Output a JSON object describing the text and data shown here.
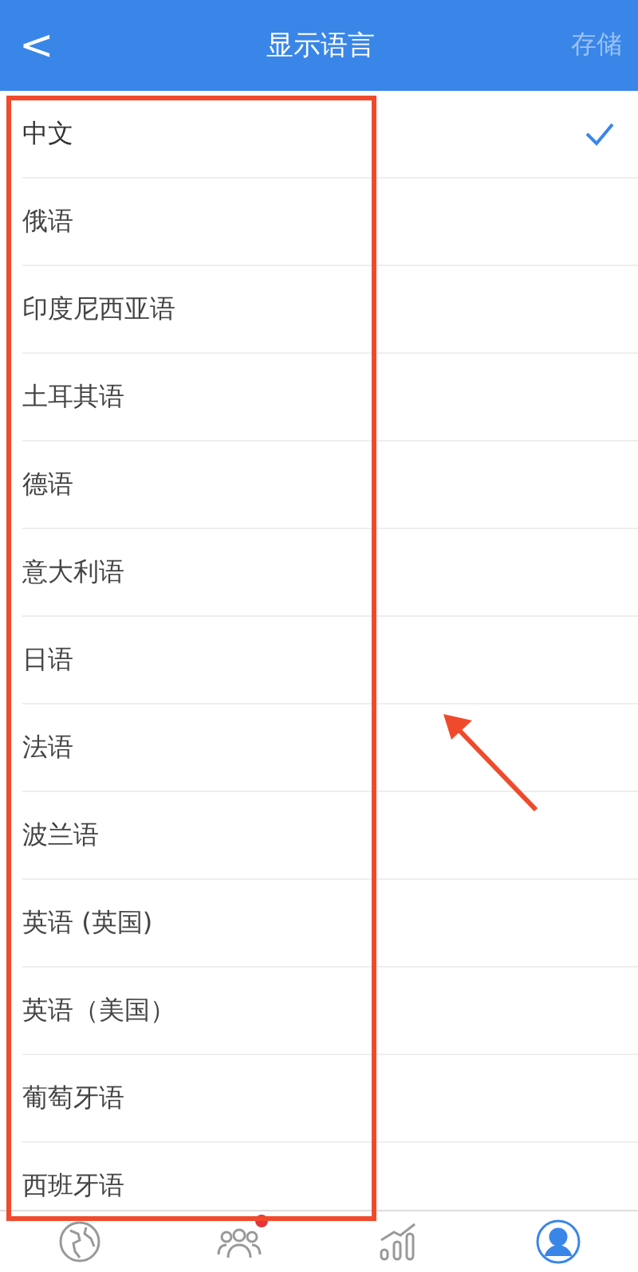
{
  "header": {
    "back": "<",
    "title": "显示语言",
    "save": {
      "label": "存储",
      "disabled": true
    }
  },
  "languages": [
    {
      "label": "中文",
      "selected": true
    },
    {
      "label": "俄语",
      "selected": false
    },
    {
      "label": "印度尼西亚语",
      "selected": false
    },
    {
      "label": "土耳其语",
      "selected": false
    },
    {
      "label": "德语",
      "selected": false
    },
    {
      "label": "意大利语",
      "selected": false
    },
    {
      "label": "日语",
      "selected": false
    },
    {
      "label": "法语",
      "selected": false
    },
    {
      "label": "波兰语",
      "selected": false
    },
    {
      "label": "英语 (英国)",
      "selected": false
    },
    {
      "label": "英语（美国）",
      "selected": false
    },
    {
      "label": "葡萄牙语",
      "selected": false
    },
    {
      "label": "西班牙语",
      "selected": false
    }
  ],
  "tab_bar": [
    {
      "kind": "globe",
      "selected": false,
      "badge": false
    },
    {
      "kind": "people",
      "selected": false,
      "badge": true
    },
    {
      "kind": "chart",
      "selected": false,
      "badge": false
    },
    {
      "kind": "person",
      "selected": true,
      "badge": false
    }
  ]
}
